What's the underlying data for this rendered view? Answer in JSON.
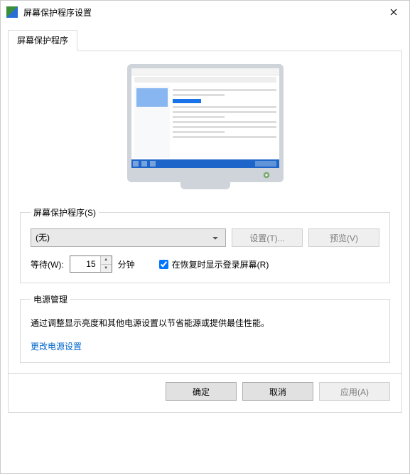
{
  "window": {
    "title": "屏幕保护程序设置"
  },
  "tab": {
    "label": "屏幕保护程序"
  },
  "screensaver": {
    "group_label": "屏幕保护程序(S)",
    "selected": "(无)",
    "settings_btn": "设置(T)...",
    "preview_btn": "预览(V)",
    "wait_label": "等待(W):",
    "wait_value": "15",
    "wait_unit": "分钟",
    "resume_label": "在恢复时显示登录屏幕(R)"
  },
  "power": {
    "group_label": "电源管理",
    "desc": "通过调整显示亮度和其他电源设置以节省能源或提供最佳性能。",
    "link": "更改电源设置"
  },
  "buttons": {
    "ok": "确定",
    "cancel": "取消",
    "apply": "应用(A)"
  }
}
